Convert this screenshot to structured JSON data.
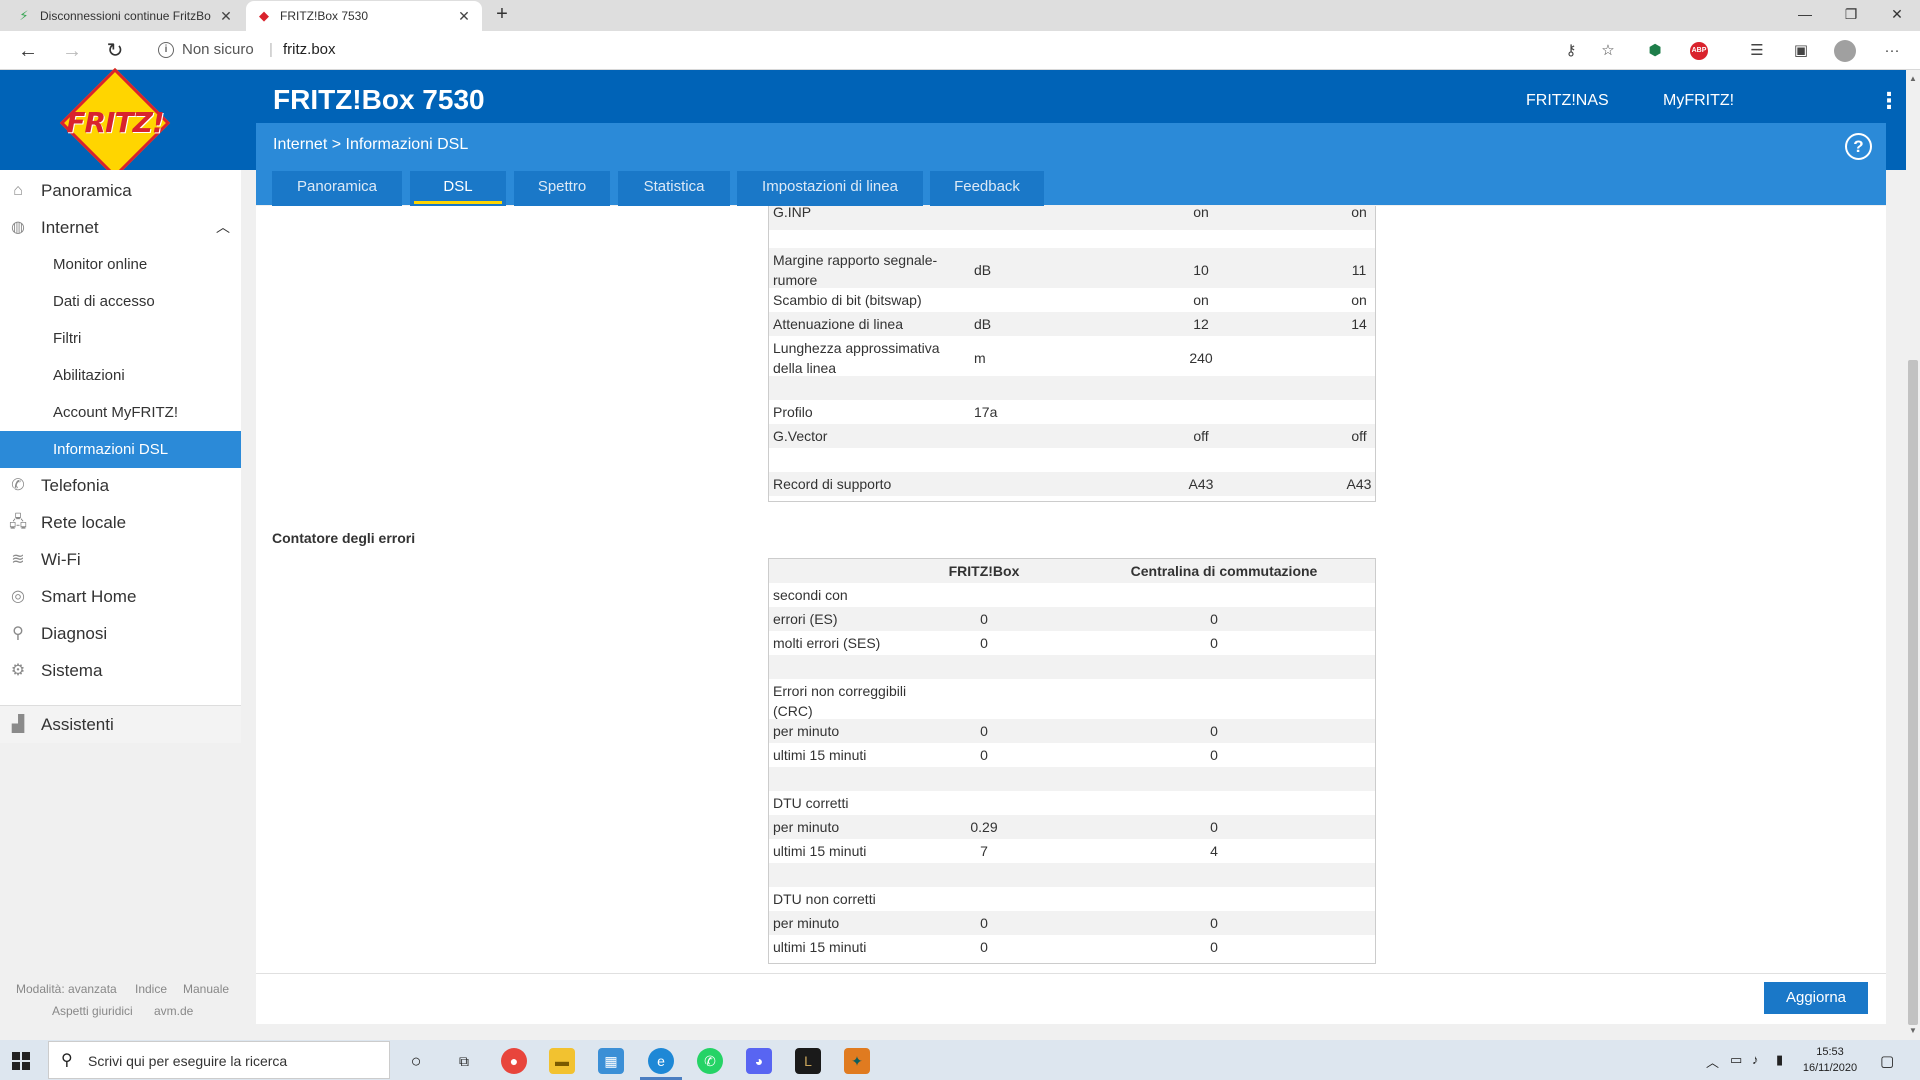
{
  "browser": {
    "tabs": [
      {
        "title": "Disconnessioni continue FritzBo",
        "icon": "bolt-icon"
      },
      {
        "title": "FRITZ!Box 7530",
        "icon": "fritz-tab-icon"
      }
    ],
    "security_label": "Non sicuro",
    "url": "fritz.box"
  },
  "header": {
    "logo_text": "FRITZ!",
    "product": "FRITZ!Box 7530",
    "links": [
      "FRITZ!NAS",
      "MyFRITZ!"
    ],
    "breadcrumb": "Internet > Informazioni DSL",
    "help": "?"
  },
  "tabs": [
    {
      "label": "Panoramica",
      "active": false
    },
    {
      "label": "DSL",
      "active": true
    },
    {
      "label": "Spettro",
      "active": false
    },
    {
      "label": "Statistica",
      "active": false
    },
    {
      "label": "Impostazioni di linea",
      "active": false
    },
    {
      "label": "Feedback",
      "active": false
    }
  ],
  "sidebar": {
    "items": [
      {
        "label": "Panoramica",
        "icon": "home-icon"
      },
      {
        "label": "Internet",
        "icon": "globe-icon"
      },
      {
        "label": "Telefonia",
        "icon": "phone-icon"
      },
      {
        "label": "Rete locale",
        "icon": "network-icon"
      },
      {
        "label": "Wi-Fi",
        "icon": "wifi-icon"
      },
      {
        "label": "Smart Home",
        "icon": "smart-home-icon"
      },
      {
        "label": "Diagnosi",
        "icon": "diagnosis-icon"
      },
      {
        "label": "Sistema",
        "icon": "system-icon"
      },
      {
        "label": "Assistenti",
        "icon": "wizard-icon"
      }
    ],
    "internet_sub": [
      {
        "label": "Monitor online",
        "active": false
      },
      {
        "label": "Dati di accesso",
        "active": false
      },
      {
        "label": "Filtri",
        "active": false
      },
      {
        "label": "Abilitazioni",
        "active": false
      },
      {
        "label": "Account MyFRITZ!",
        "active": false
      },
      {
        "label": "Informazioni DSL",
        "active": true
      }
    ],
    "footer": {
      "mode": "Modalità: avanzata",
      "index": "Indice",
      "manual": "Manuale",
      "legal": "Aspetti giuridici",
      "site": "avm.de"
    }
  },
  "dsl_rows": [
    {
      "label": "G.INP",
      "unit": "",
      "down": "on",
      "up": "on"
    },
    {
      "label": "",
      "unit": "",
      "down": "",
      "up": ""
    },
    {
      "label": "Margine rapporto segnale-",
      "label2": "rumore",
      "unit": "dB",
      "down": "10",
      "up": "11"
    },
    {
      "label": "Scambio di bit (bitswap)",
      "unit": "",
      "down": "on",
      "up": "on"
    },
    {
      "label": "Attenuazione di linea",
      "unit": "dB",
      "down": "12",
      "up": "14"
    },
    {
      "label": "Lunghezza approssimativa",
      "label2": "della linea",
      "unit": "m",
      "down": "240",
      "up": ""
    },
    {
      "label": "",
      "unit": "",
      "down": "",
      "up": ""
    },
    {
      "label": "Profilo",
      "unit": "17a",
      "down": "",
      "up": ""
    },
    {
      "label": "G.Vector",
      "unit": "",
      "down": "off",
      "up": "off"
    },
    {
      "label": "",
      "unit": "",
      "down": "",
      "up": ""
    },
    {
      "label": "Record di supporto",
      "unit": "",
      "down": "A43",
      "up": "A43"
    }
  ],
  "errors": {
    "title": "Contatore degli errori",
    "col_fritzbox": "FRITZ!Box",
    "col_exchange": "Centralina di commutazione",
    "rows": [
      {
        "label": "secondi con",
        "a": "",
        "b": ""
      },
      {
        "label": "errori (ES)",
        "a": "0",
        "b": "0"
      },
      {
        "label": "molti errori (SES)",
        "a": "0",
        "b": "0"
      },
      {
        "label": "",
        "a": "",
        "b": ""
      },
      {
        "label": "Errori non correggibili",
        "label2": "(CRC)",
        "a": "",
        "b": ""
      },
      {
        "label": "per minuto",
        "a": "0",
        "b": "0"
      },
      {
        "label": "ultimi 15 minuti",
        "a": "0",
        "b": "0"
      },
      {
        "label": "",
        "a": "",
        "b": ""
      },
      {
        "label": "DTU corretti",
        "a": "",
        "b": ""
      },
      {
        "label": "per minuto",
        "a": "0.29",
        "b": "0"
      },
      {
        "label": "ultimi 15 minuti",
        "a": "7",
        "b": "4"
      },
      {
        "label": "",
        "a": "",
        "b": ""
      },
      {
        "label": "DTU non corretti",
        "a": "",
        "b": ""
      },
      {
        "label": "per minuto",
        "a": "0",
        "b": "0"
      },
      {
        "label": "ultimi 15 minuti",
        "a": "0",
        "b": "0"
      }
    ]
  },
  "refresh_label": "Aggiorna",
  "taskbar": {
    "search_placeholder": "Scrivi qui per eseguire la ricerca",
    "time": "15:53",
    "date": "16/11/2020"
  },
  "colors": {
    "brand_blue": "#0063b7",
    "accent_yellow": "#ffd500",
    "logo_red": "#d9232d"
  }
}
